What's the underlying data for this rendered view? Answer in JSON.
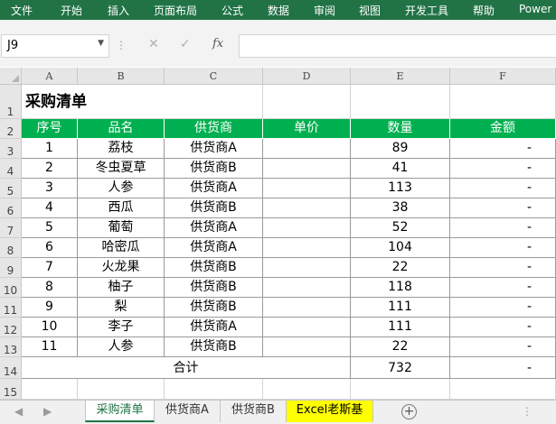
{
  "ribbon": {
    "tabs": [
      "文件",
      "开始",
      "插入",
      "页面布局",
      "公式",
      "数据",
      "审阅",
      "视图",
      "开发工具",
      "帮助",
      "Power"
    ]
  },
  "formula_bar": {
    "name_box": "J9",
    "fx": "fx",
    "content": ""
  },
  "sheet": {
    "columns": [
      "A",
      "B",
      "C",
      "D",
      "E",
      "F"
    ],
    "rows": [
      "1",
      "2",
      "3",
      "4",
      "5",
      "6",
      "7",
      "8",
      "9",
      "10",
      "11",
      "12",
      "13",
      "14",
      "15"
    ],
    "title": "采购清单",
    "headers": [
      "序号",
      "品名",
      "供货商",
      "单价",
      "数量",
      "金额"
    ],
    "data": [
      [
        "1",
        "荔枝",
        "供货商A",
        "",
        "89",
        "-"
      ],
      [
        "2",
        "冬虫夏草",
        "供货商B",
        "",
        "41",
        "-"
      ],
      [
        "3",
        "人参",
        "供货商A",
        "",
        "113",
        "-"
      ],
      [
        "4",
        "西瓜",
        "供货商B",
        "",
        "38",
        "-"
      ],
      [
        "5",
        "葡萄",
        "供货商A",
        "",
        "52",
        "-"
      ],
      [
        "6",
        "哈密瓜",
        "供货商A",
        "",
        "104",
        "-"
      ],
      [
        "7",
        "火龙果",
        "供货商B",
        "",
        "22",
        "-"
      ],
      [
        "8",
        "柚子",
        "供货商B",
        "",
        "118",
        "-"
      ],
      [
        "9",
        "梨",
        "供货商B",
        "",
        "111",
        "-"
      ],
      [
        "10",
        "李子",
        "供货商A",
        "",
        "111",
        "-"
      ],
      [
        "11",
        "人参",
        "供货商B",
        "",
        "22",
        "-"
      ]
    ],
    "total": {
      "label": "合计",
      "qty": "732",
      "amount": "-"
    }
  },
  "sheet_tabs": [
    {
      "label": "采购清单",
      "active": true
    },
    {
      "label": "供货商A"
    },
    {
      "label": "供货商B"
    },
    {
      "label": "Excel老斯基",
      "highlight": true
    }
  ],
  "colors": {
    "ribbon": "#217346",
    "header_fill": "#00b050",
    "tab_highlight": "#ffff00"
  }
}
